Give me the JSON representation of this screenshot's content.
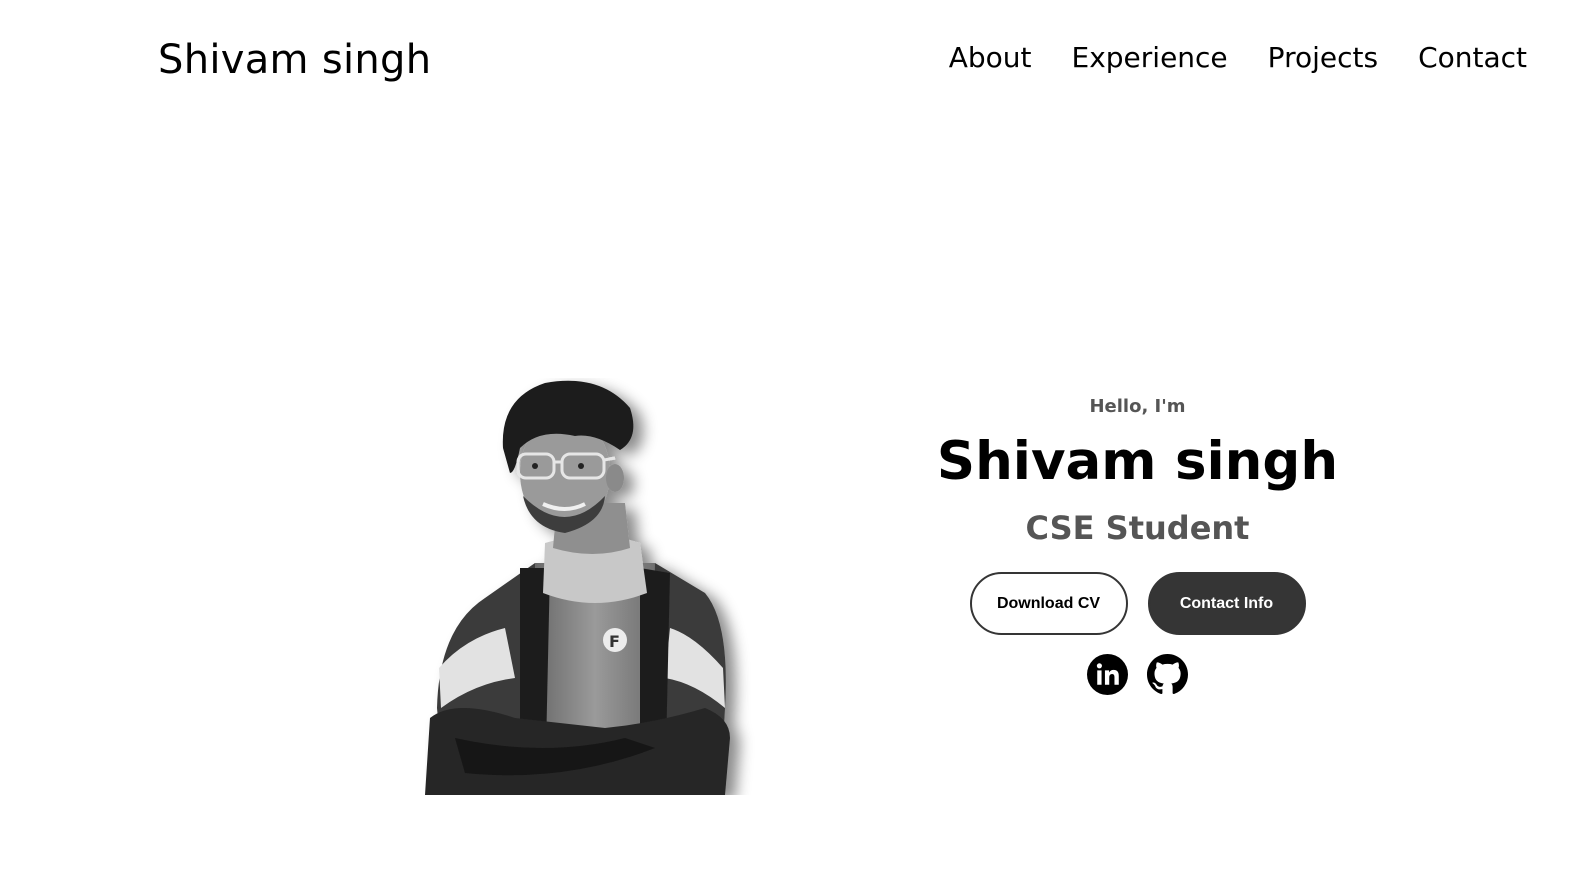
{
  "header": {
    "logo": "Shivam singh",
    "nav": [
      "About",
      "Experience",
      "Projects",
      "Contact"
    ]
  },
  "hero": {
    "greeting": "Hello, I'm",
    "name": "Shivam singh",
    "role": "CSE Student",
    "buttons": {
      "download_cv": "Download CV",
      "contact_info": "Contact Info"
    },
    "socials": [
      {
        "icon": "linkedin-icon"
      },
      {
        "icon": "github-icon"
      }
    ],
    "profile_image": {
      "style": "grayscale"
    }
  },
  "colors": {
    "text": "#000000",
    "muted": "#555555",
    "button_dark": "#353535",
    "background": "#ffffff"
  }
}
